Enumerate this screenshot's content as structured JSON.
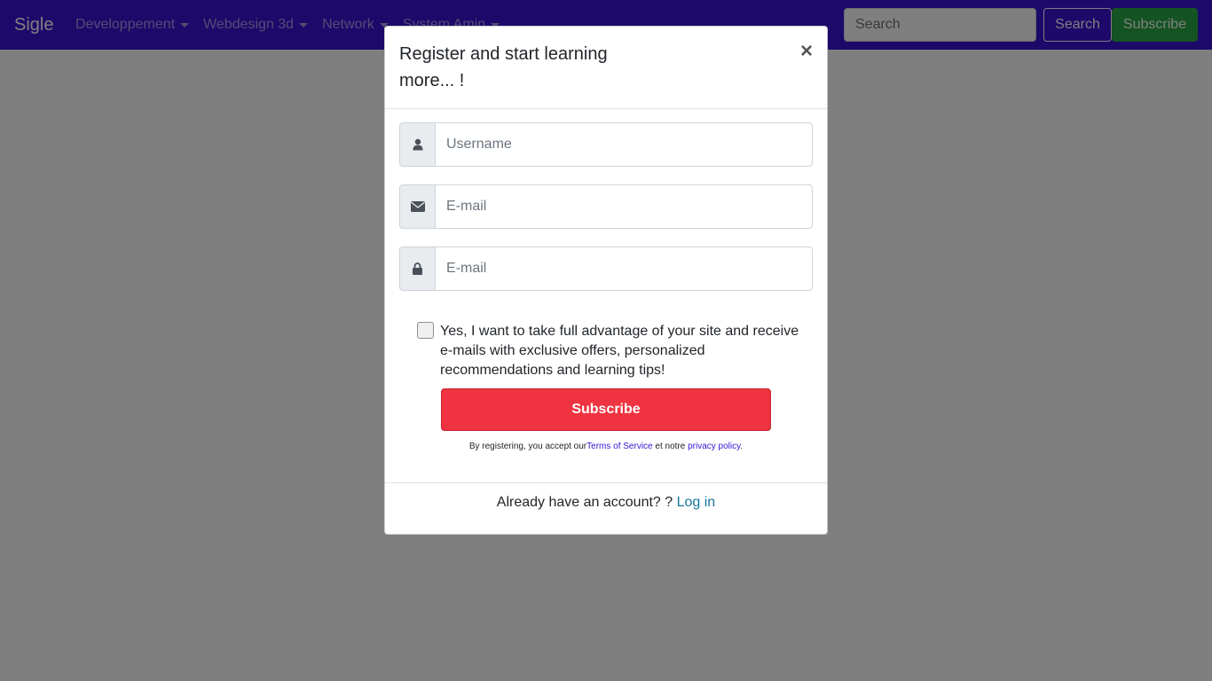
{
  "navbar": {
    "brand": "Sigle",
    "items": [
      {
        "label": "Developpement"
      },
      {
        "label": "Webdesign 3d"
      },
      {
        "label": "Network"
      },
      {
        "label": "System Amin"
      }
    ],
    "search_placeholder": "Search",
    "search_button": "Search",
    "subscribe_button": "Subscribe",
    "background_color": "#3a12d4"
  },
  "modal": {
    "title": "Register and start learning more... !",
    "close_symbol": "×",
    "username_placeholder": "Username",
    "email_placeholder": "E-mail",
    "password_placeholder": "E-mail",
    "username_icon": "user-icon",
    "email_icon": "envelope-icon",
    "password_icon": "lock-icon",
    "checkbox_checked": false,
    "checkbox_label": "Yes, I want to take full advantage of your site and receive e-mails with exclusive offers, personalized recommendations and learning tips!",
    "subscribe_button": "Subscribe",
    "subscribe_color": "#ef3340",
    "terms_prefix": "By registering, you accept our",
    "terms_link": "Terms of Service",
    "terms_middle": " et notre ",
    "privacy_link": "privacy policy",
    "terms_suffix": ".",
    "footer_text": "Already have an account? ? ",
    "login_link": "Log in"
  }
}
